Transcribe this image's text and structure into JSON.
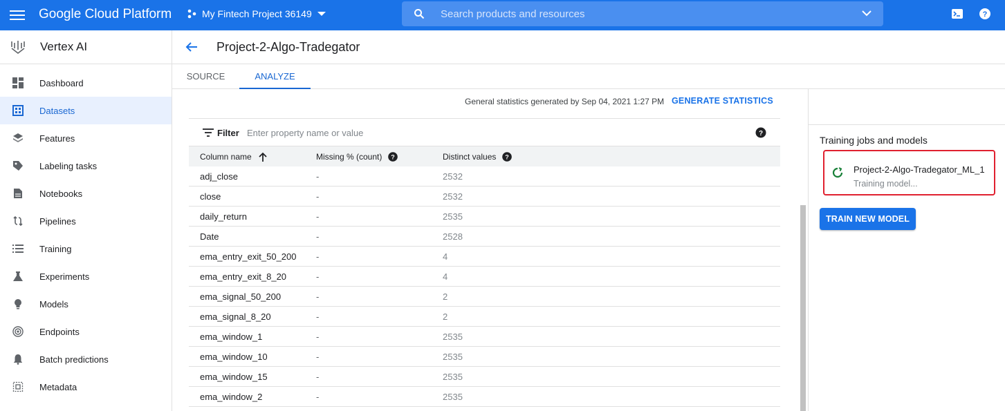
{
  "topbar": {
    "brand": "Google Cloud Platform",
    "project": "My Fintech Project 36149",
    "search_placeholder": "Search products and resources",
    "color": "#1a73e8"
  },
  "sidebar": {
    "title": "Vertex AI",
    "items": [
      {
        "label": "Dashboard",
        "icon": "dashboard-icon"
      },
      {
        "label": "Datasets",
        "icon": "datasets-icon",
        "active": true
      },
      {
        "label": "Features",
        "icon": "features-icon"
      },
      {
        "label": "Labeling tasks",
        "icon": "label-icon"
      },
      {
        "label": "Notebooks",
        "icon": "notebook-icon"
      },
      {
        "label": "Pipelines",
        "icon": "pipelines-icon"
      },
      {
        "label": "Training",
        "icon": "training-icon"
      },
      {
        "label": "Experiments",
        "icon": "flask-icon"
      },
      {
        "label": "Models",
        "icon": "bulb-icon"
      },
      {
        "label": "Endpoints",
        "icon": "endpoint-icon"
      },
      {
        "label": "Batch predictions",
        "icon": "bell-icon"
      },
      {
        "label": "Metadata",
        "icon": "metadata-icon"
      }
    ]
  },
  "page": {
    "title": "Project-2-Algo-Tradegator",
    "tabs": [
      "SOURCE",
      "ANALYZE"
    ],
    "active_tab": "ANALYZE",
    "stats_text": "General statistics generated by Sep 04, 2021 1:27 PM",
    "generate_label": "GENERATE STATISTICS",
    "filter_label": "Filter",
    "filter_placeholder": "Enter property name or value"
  },
  "table": {
    "headers": [
      "Column name",
      "Missing % (count)",
      "Distinct values"
    ],
    "rows": [
      [
        "adj_close",
        "-",
        "2532"
      ],
      [
        "close",
        "-",
        "2532"
      ],
      [
        "daily_return",
        "-",
        "2535"
      ],
      [
        "Date",
        "-",
        "2528"
      ],
      [
        "ema_entry_exit_50_200",
        "-",
        "4"
      ],
      [
        "ema_entry_exit_8_20",
        "-",
        "4"
      ],
      [
        "ema_signal_50_200",
        "-",
        "2"
      ],
      [
        "ema_signal_8_20",
        "-",
        "2"
      ],
      [
        "ema_window_1",
        "-",
        "2535"
      ],
      [
        "ema_window_10",
        "-",
        "2535"
      ],
      [
        "ema_window_15",
        "-",
        "2535"
      ],
      [
        "ema_window_2",
        "-",
        "2535"
      ]
    ]
  },
  "right_panel": {
    "title": "Training jobs and models",
    "job_name": "Project-2-Algo-Tradegator_ML_1",
    "job_status": "Training model...",
    "train_button": "TRAIN NEW MODEL",
    "highlight_color": "#e0202f"
  }
}
